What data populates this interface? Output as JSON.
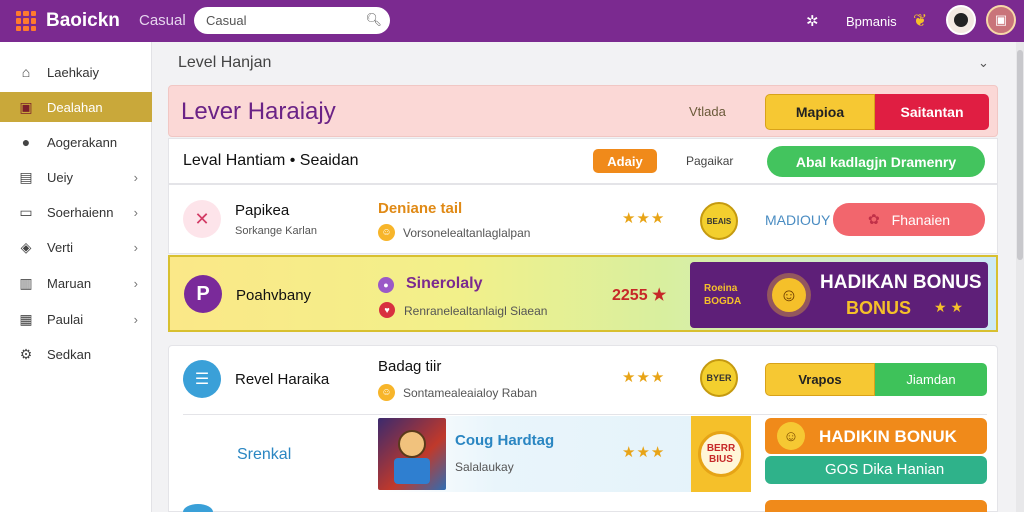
{
  "topbar": {
    "brand": "Baoickn",
    "category": "Casual",
    "search_value": "Casual",
    "user_label": "Bpmanis"
  },
  "sidebar": {
    "items": [
      {
        "label": "Laehkaiy",
        "icon": "home-icon",
        "chevron": false
      },
      {
        "label": "Dealahan",
        "icon": "badge-icon",
        "chevron": false
      },
      {
        "label": "Aogerakann",
        "icon": "user-icon",
        "chevron": false
      },
      {
        "label": "Ueiy",
        "icon": "book-icon",
        "chevron": true
      },
      {
        "label": "Soerhaienn",
        "icon": "window-icon",
        "chevron": true
      },
      {
        "label": "Verti",
        "icon": "tag-icon",
        "chevron": true
      },
      {
        "label": "Maruan",
        "icon": "basket-icon",
        "chevron": true
      },
      {
        "label": "Paulai",
        "icon": "chart-icon",
        "chevron": true
      },
      {
        "label": "Sedkan",
        "icon": "settings-icon",
        "chevron": false
      }
    ]
  },
  "breadcrumb": "Level Hanjan",
  "hero": {
    "title": "Lever Haraiajy",
    "tag": "Vtlada",
    "btn_primary": "Mapioa",
    "btn_secondary": "Saitantan"
  },
  "subheader": {
    "title": "Leval Hantiam • Seaidan",
    "apply": "Adaiy",
    "pager": "Pagaikar",
    "promo": "Abal  kadlagjn  Dramenry"
  },
  "rows": [
    {
      "name": "Papikea",
      "sub": "Sorkange Karlan",
      "title": "Deniane tail",
      "desc": "Vorsonelealtanlaglalpan",
      "stars": "★★★",
      "badge": "BEAIS",
      "action": "Fhanaien",
      "aside": "MADIOUY"
    },
    {
      "name": "Poahvbany",
      "title": "Sinerolaly",
      "desc": "Renranelealtanlaigl Siaean",
      "rating": "2255 ★",
      "banner_title": "HADIKAN BONUS",
      "banner_sub": "BONUS",
      "banner_left": "Roeina BOGDA"
    },
    {
      "name": "Revel Haraika",
      "title": "Badag  tiir",
      "desc": "Sontamealeaialoy Raban",
      "stars": "★★★",
      "badge": "BYER",
      "btn_primary": "Vrapos",
      "btn_secondary": "Jiamdan"
    },
    {
      "name": "Srenkal",
      "title": "Coug Hardtag",
      "desc": "Salalaukay",
      "stars": "★★★",
      "badge": "BERR BIUS",
      "bonus_title": "HADIKIN BONUK",
      "bonus_sub": "GOS Dika Hanian"
    }
  ],
  "colors": {
    "topbar": "#7b2a90",
    "active": "#c9a83a",
    "accent_red": "#e01e42",
    "accent_gold": "#f5c02a",
    "accent_green": "#3ec25a"
  }
}
